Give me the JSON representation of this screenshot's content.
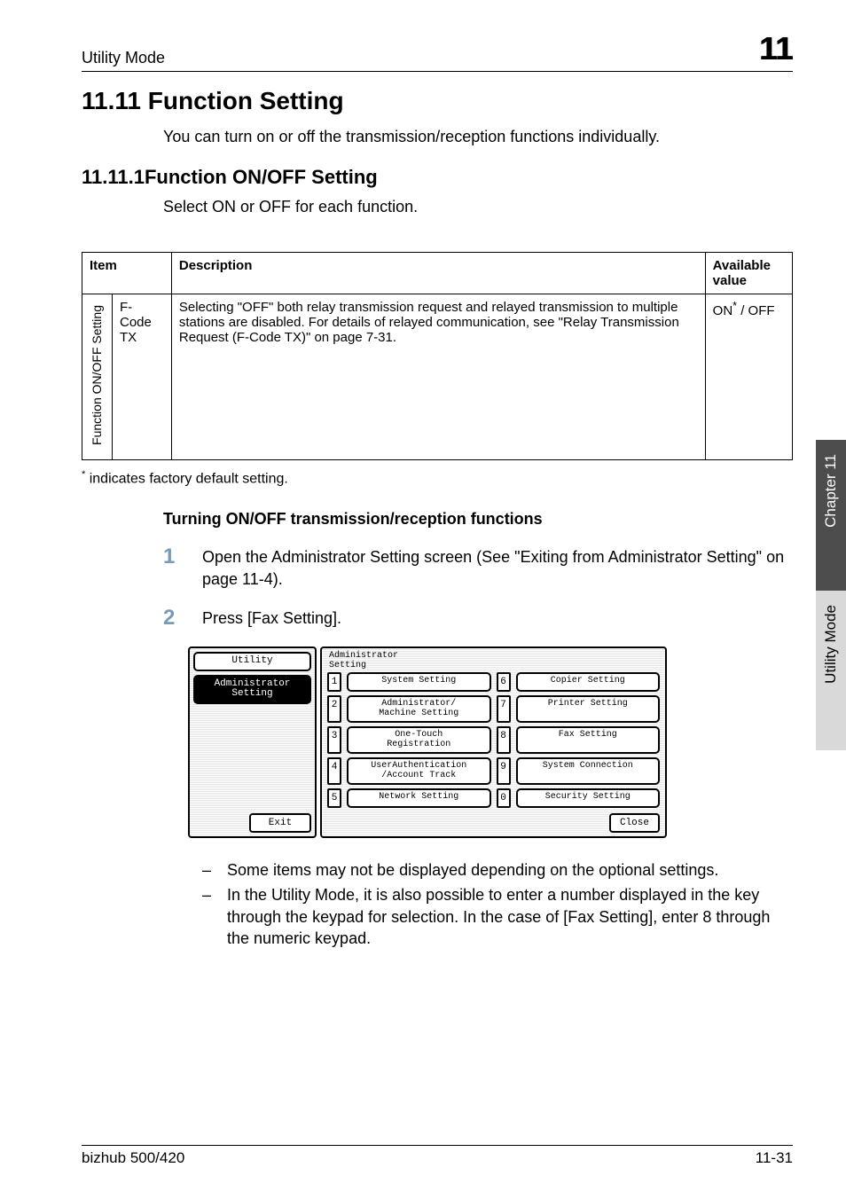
{
  "header": {
    "left": "Utility Mode",
    "chapter": "11"
  },
  "section": {
    "title": "11.11 Function Setting",
    "intro": "You can turn on or off the transmission/reception functions individually."
  },
  "subsection": {
    "title": "11.11.1Function ON/OFF Setting",
    "intro": "Select ON or OFF for each function."
  },
  "table": {
    "headers": {
      "item": "Item",
      "desc": "Description",
      "avail": "Available value"
    },
    "rowgroup_label": "Function ON/OFF Setting",
    "row": {
      "item": "F-Code TX",
      "desc": "Selecting \"OFF\" both relay transmission request and relayed transmission to multiple stations are disabled. For details of relayed communication, see \"Relay Transmission Request (F-Code TX)\" on page 7-31.",
      "avail_prefix": "ON",
      "avail_suffix": " / OFF"
    }
  },
  "footnote": " indicates factory default setting.",
  "subheading": "Turning ON/OFF transmission/reception functions",
  "steps": {
    "s1": {
      "num": "1",
      "body": "Open the Administrator Setting screen (See \"Exiting from Administrator Setting\" on page 11-4)."
    },
    "s2": {
      "num": "2",
      "body": "Press [Fax Setting]."
    }
  },
  "ui": {
    "left": {
      "utility": "Utility",
      "admin": "Administrator\nSetting",
      "exit": "Exit"
    },
    "title": "Administrator\nSetting",
    "buttons": {
      "n1": "1",
      "b1": "System Setting",
      "n2": "2",
      "b2": "Administrator/\nMachine Setting",
      "n3": "3",
      "b3": "One-Touch\nRegistration",
      "n4": "4",
      "b4": "UserAuthentication\n/Account Track",
      "n5": "5",
      "b5": "Network Setting",
      "n6": "6",
      "b6": "Copier Setting",
      "n7": "7",
      "b7": "Printer Setting",
      "n8": "8",
      "b8": "Fax Setting",
      "n9": "9",
      "b9": "System Connection",
      "n0": "0",
      "b0": "Security Setting"
    },
    "close": "Close"
  },
  "bullets": {
    "b1": "Some items may not be displayed depending on the optional settings.",
    "b2": "In the Utility Mode, it is also possible to enter a number displayed in the key through the keypad for selection. In the case of [Fax Setting], enter 8 through the numeric keypad."
  },
  "side": {
    "dark": "Chapter 11",
    "light": "Utility Mode"
  },
  "footer": {
    "left": "bizhub 500/420",
    "right": "11-31"
  }
}
